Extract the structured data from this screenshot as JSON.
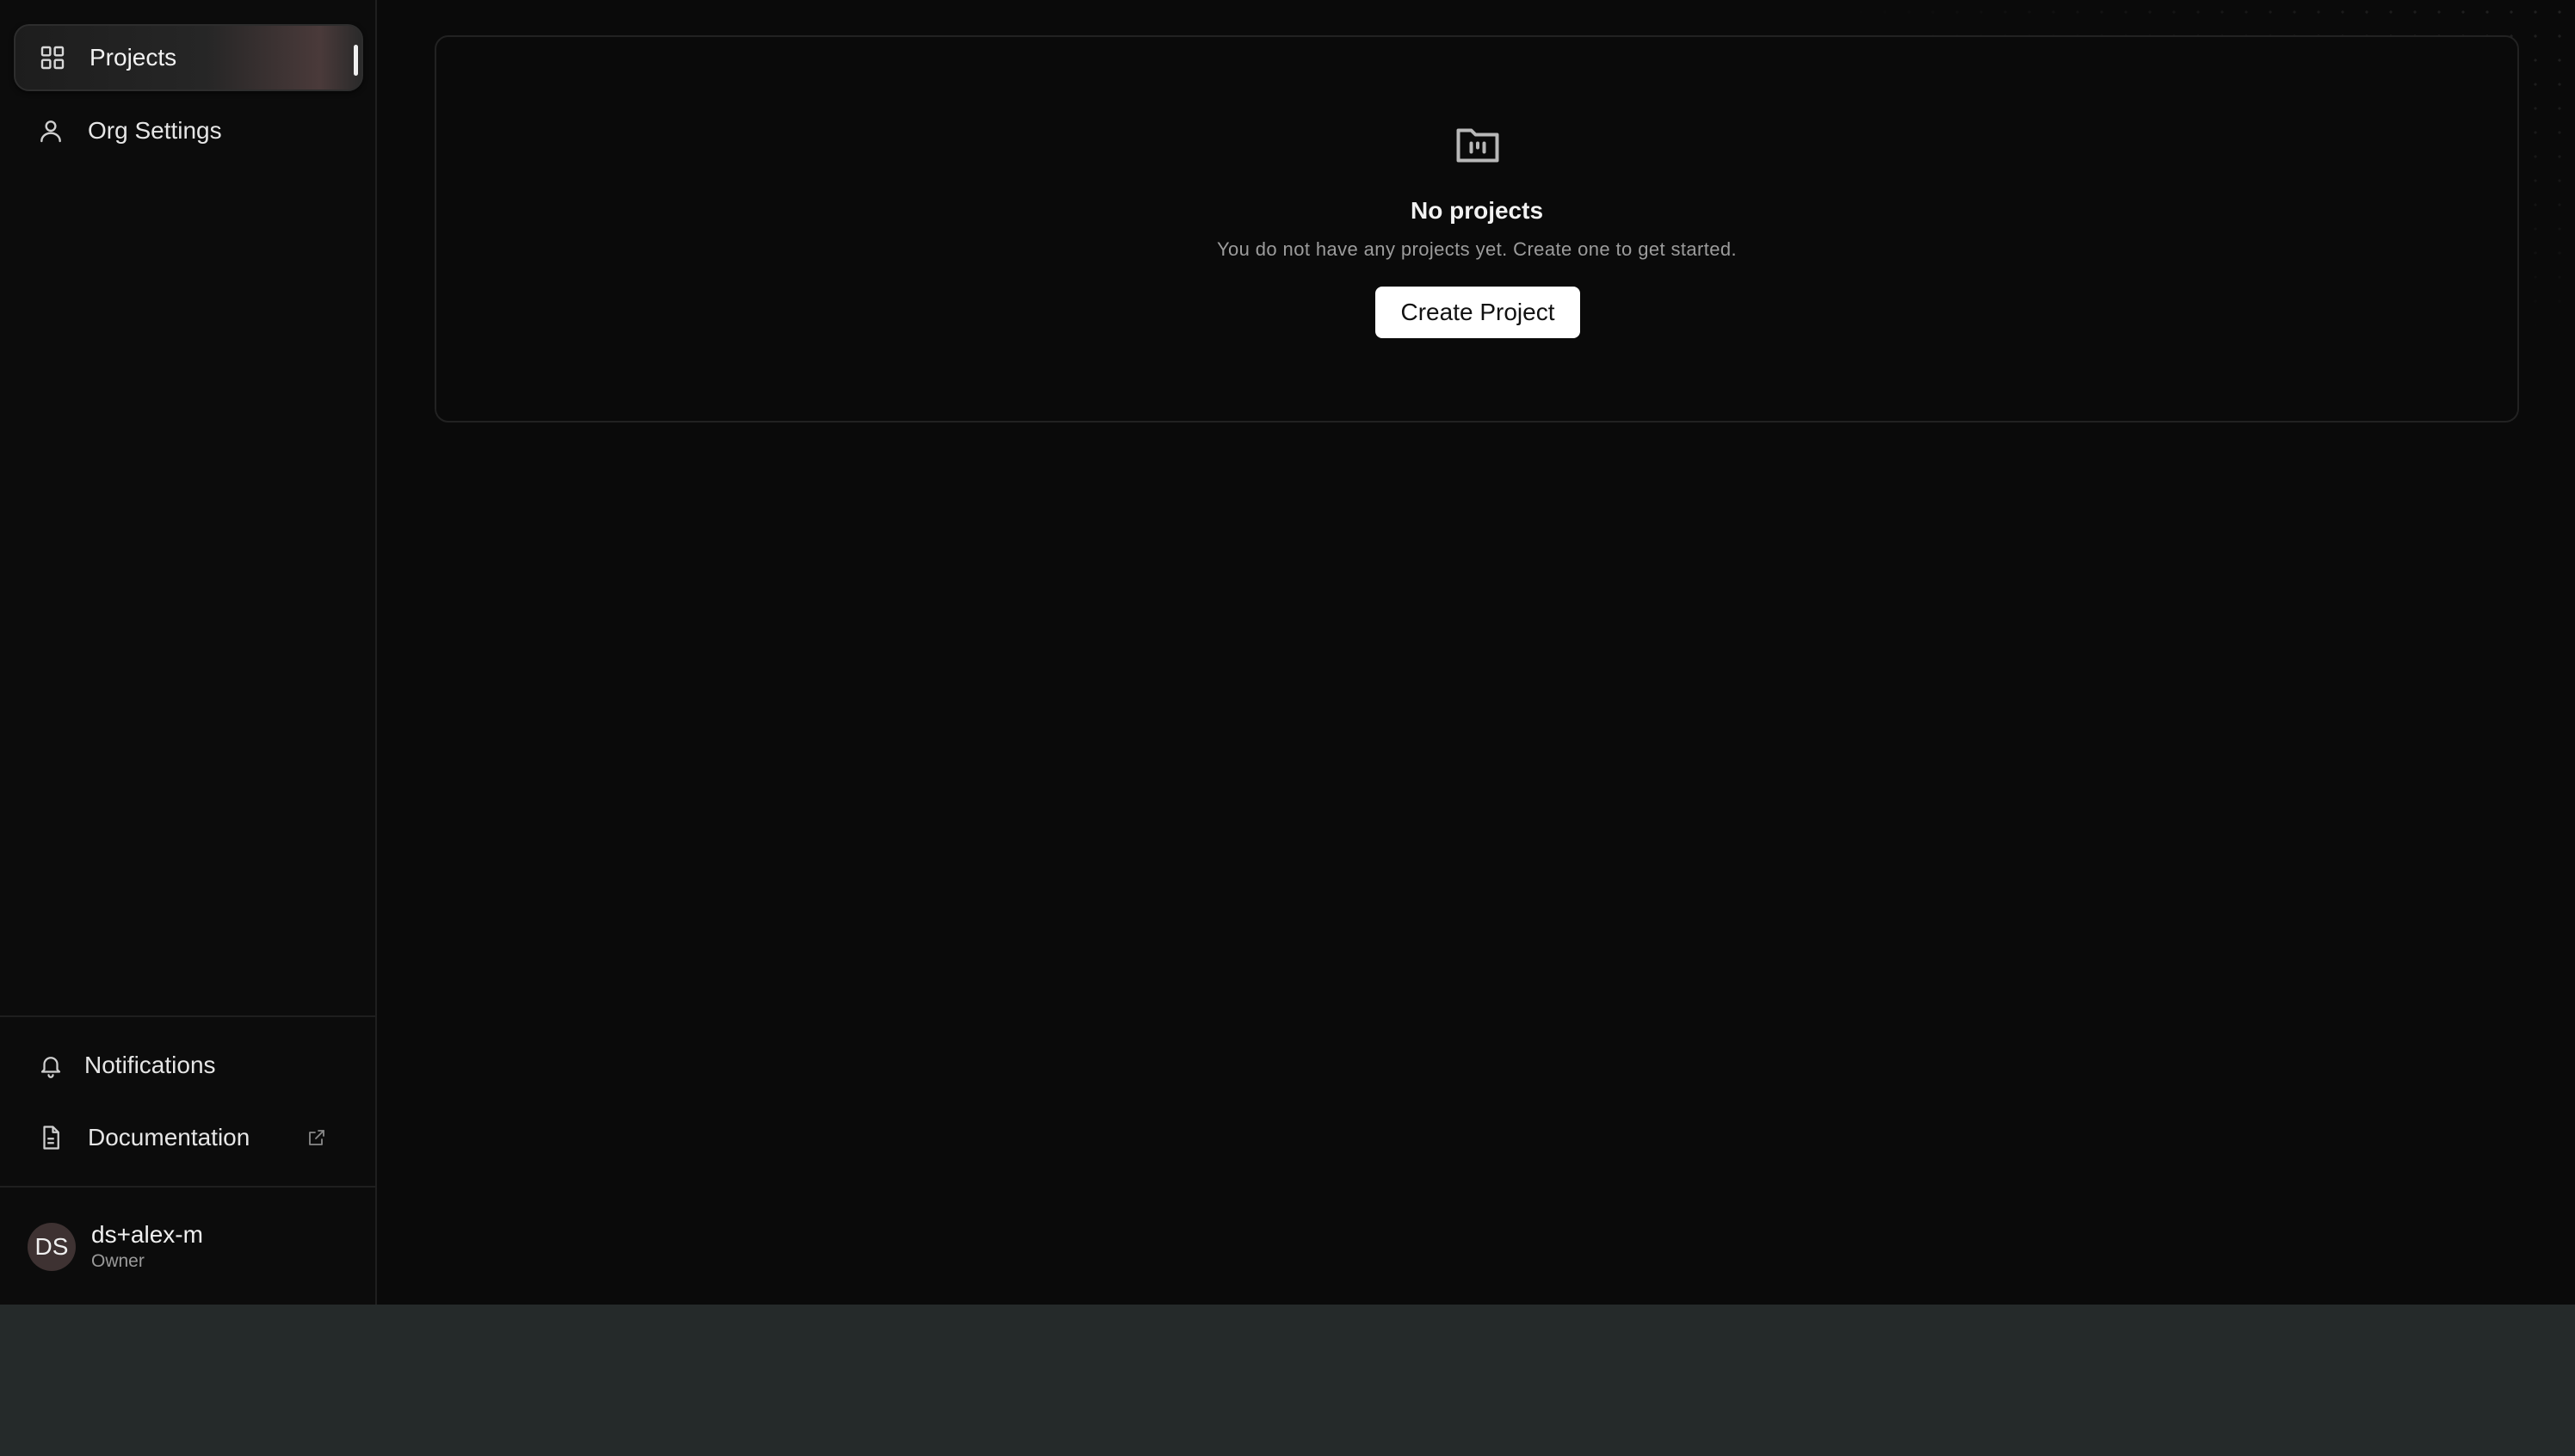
{
  "sidebar": {
    "nav": [
      {
        "label": "Projects",
        "icon": "grid-icon",
        "active": true
      },
      {
        "label": "Org Settings",
        "icon": "user-icon",
        "active": false
      }
    ],
    "footer_links": [
      {
        "label": "Notifications",
        "icon": "bell-icon"
      },
      {
        "label": "Documentation",
        "icon": "document-icon",
        "external_icon": "external-link-icon"
      }
    ],
    "user": {
      "initials": "DS",
      "name": "ds+alex-m",
      "role": "Owner"
    }
  },
  "main": {
    "empty_state": {
      "icon": "folder-icon",
      "title": "No projects",
      "subtitle": "You do not have any projects yet. Create one to get started.",
      "button_label": "Create Project"
    }
  },
  "colors": {
    "background": "#0a0a0a",
    "page_bottom": "#252a2a",
    "button_bg": "#ffffff",
    "avatar_bg": "#3e3232"
  }
}
